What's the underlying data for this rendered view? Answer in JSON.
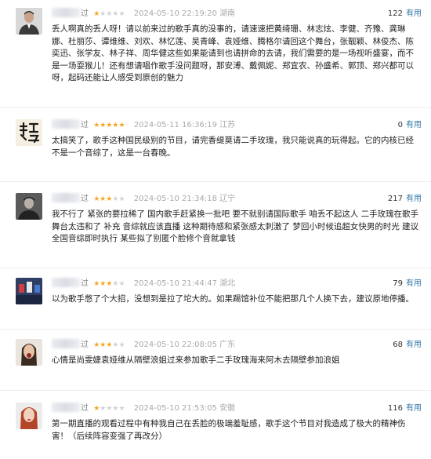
{
  "star_colors": {
    "on": "#f5a623",
    "off": "#cfd2d6"
  },
  "useful_label": "有用",
  "reviews": [
    {
      "user_suffix": "过",
      "rating": 1,
      "date": "2024-05-10 22:19:20",
      "location": "湖南",
      "votes": "122",
      "avatar_icon": "man-in-suit-portrait",
      "content": "丢人啊真的丢人呀！请以前来过的歌手真的没事的，请速速把黄绮珊、林志炫、李健、齐豫、龚琳娜、杜丽莎、谭维维、刘欢、林忆莲、吴青峰、袁娅维、腾格尔请回这个舞台，张靓颖、林俊杰、陈奕迅、张学友、林子祥、周华健这些如果能请到也请拼命的去请，我们需要的是一场视听盛宴，而不是一场耍猴儿！还有想请唱作歌手没问题呀，那安溥、戴佩妮、郑宜农、孙盛希、郭顶、郑兴都可以呀，起码还能让人感受到原创的魅力"
    },
    {
      "user_suffix": "过",
      "rating": 5,
      "date": "2024-05-11 16:36:19",
      "location": "江苏",
      "votes": "0",
      "avatar_icon": "calligraphy-character-avatar",
      "content": "太搞笑了，歌手这种国民级别的节目，请完香缇莫请二手玫瑰，我只能说真的玩得起。它的内核已经不是一个音综了，这是一台春晚。"
    },
    {
      "user_suffix": "过",
      "rating": 3,
      "date": "2024-05-10 21:34:18",
      "location": "辽宁",
      "votes": "217",
      "avatar_icon": "man-dark-portrait",
      "content": "我不行了 紧张的要拉稀了 国内歌手赶紧换一批吧 要不就别请国际歌手 咱丢不起这人 二手玫瑰在歌手舞台太违和了 补充 音综就应该直播 这种期待感和紧张感太刺激了 梦回小时候追超女快男的时光 建议全国音综即时执行 某些拟了别匿个脸修个音就拿钱"
    },
    {
      "user_suffix": "过",
      "rating": 3,
      "date": "2024-05-10 21:44:47",
      "location": "湖北",
      "votes": "79",
      "avatar_icon": "stage-scene-avatar",
      "content": "以为歌手憋了个大招，没想到是拉了坨大的。如果踢馆补位不能把那几个人换下去，建议原地停播。"
    },
    {
      "user_suffix": "过",
      "rating": 3,
      "date": "2024-05-10 22:08:05",
      "location": "广东",
      "votes": "68",
      "avatar_icon": "woman-shouting-avatar",
      "content": "心情是尚雯婕袁娅维从隔壁浪姐过来参加歌手二手玫瑰海来阿木去隔壁参加浪姐"
    },
    {
      "user_suffix": "过",
      "rating": 1,
      "date": "2024-05-10 21:53:05",
      "location": "安徽",
      "votes": "116",
      "avatar_icon": "red-hair-woman-avatar",
      "content": "第一期直播的观看过程中有种我自己在丢脸的极端羞耻感，歌手这个节目对我造成了极大的精神伤害！（后续阵容变强了再改分）"
    }
  ]
}
